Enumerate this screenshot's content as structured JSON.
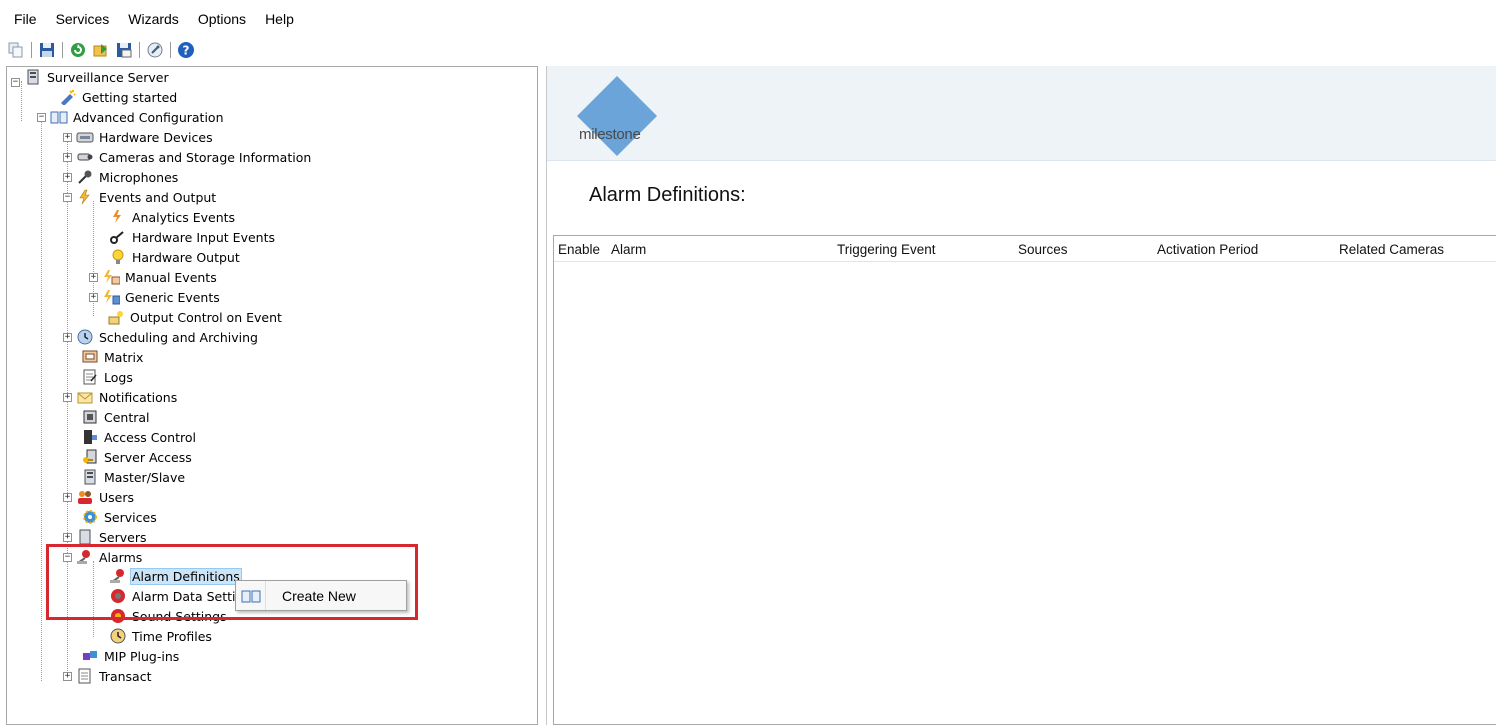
{
  "menu": [
    "File",
    "Services",
    "Wizards",
    "Options",
    "Help"
  ],
  "toolbar": [
    "copy-icon",
    "save-icon",
    "refresh-icon",
    "export-icon",
    "save-as-icon",
    "options-icon",
    "help-icon"
  ],
  "tree": {
    "root": "Surveillance Server",
    "getting_started": "Getting started",
    "advanced": "Advanced Configuration",
    "hardware_devices": "Hardware Devices",
    "cameras_storage": "Cameras and Storage Information",
    "microphones": "Microphones",
    "events_output": "Events and Output",
    "analytics_events": "Analytics Events",
    "hardware_input": "Hardware Input Events",
    "hardware_output": "Hardware Output",
    "manual_events": "Manual Events",
    "generic_events": "Generic Events",
    "output_control": "Output Control on Event",
    "scheduling": "Scheduling and Archiving",
    "matrix": "Matrix",
    "logs": "Logs",
    "notifications": "Notifications",
    "central": "Central",
    "access_control": "Access Control",
    "server_access": "Server Access",
    "master_slave": "Master/Slave",
    "users": "Users",
    "services": "Services",
    "servers": "Servers",
    "alarms": "Alarms",
    "alarm_definitions": "Alarm Definitions",
    "alarm_data_settings": "Alarm Data Setti",
    "sound_settings": "Sound Settings",
    "time_profiles": "Time Profiles",
    "mip_plugins": "MIP Plug-ins",
    "transact": "Transact"
  },
  "context_menu": {
    "create_new": "Create New"
  },
  "brand": {
    "name": "milestone",
    "color": "#5b9bd5"
  },
  "main": {
    "title": "Alarm Definitions:",
    "columns": [
      "Enable",
      "Alarm",
      "Triggering Event",
      "Sources",
      "Activation Period",
      "Related Cameras"
    ]
  },
  "colors": {
    "highlight": "#d7282f",
    "selection": "#cce4f7"
  }
}
